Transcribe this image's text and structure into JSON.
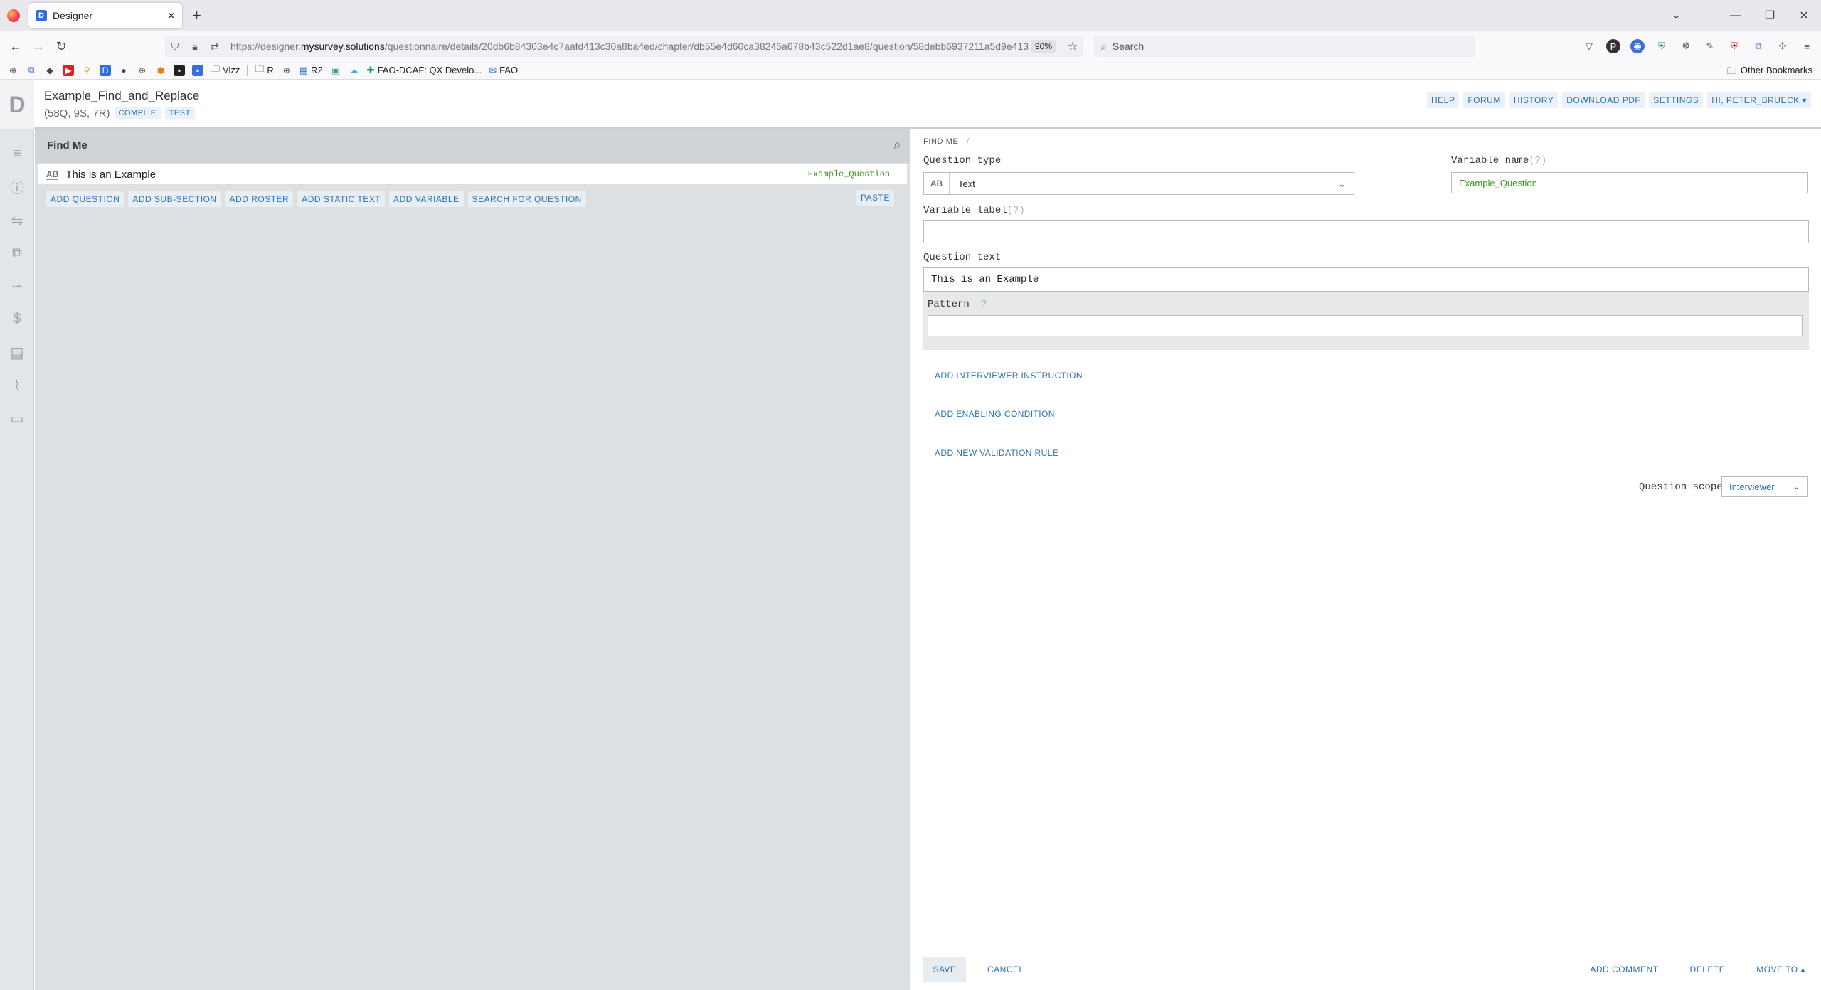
{
  "browser": {
    "tab_title": "Designer",
    "tab_favicon": "D",
    "url_host_prefix": "https://designer.",
    "url_host": "mysurvey.solutions",
    "url_path": "/questionnaire/details/20db6b84303e4c7aafd413c30a8ba4ed/chapter/db55e4d60ca38245a678b43c522d1ae8/question/58debb6937211a5d9e413",
    "zoom": "90%",
    "search_placeholder": "Search",
    "bookmarks": {
      "vizz": "Vizz",
      "r": "R",
      "r2": "R2",
      "faodcaf": "FAO-DCAF: QX Develo...",
      "fao": "FAO",
      "other": "Other Bookmarks"
    }
  },
  "header": {
    "questionnaire_title": "Example_Find_and_Replace",
    "stats": "(58Q, 9S, 7R)",
    "compile": "COMPILE",
    "test": "TEST",
    "links": {
      "help": "HELP",
      "forum": "FORUM",
      "history": "HISTORY",
      "download_pdf": "DOWNLOAD PDF",
      "settings": "SETTINGS",
      "user": "HI, PETER_BRUECK"
    }
  },
  "tree": {
    "section_title": "Find Me",
    "question": {
      "type_icon": "AB",
      "text": "This is an Example",
      "variable": "Example_Question"
    },
    "actions": {
      "add_question": "ADD QUESTION",
      "add_subsection": "ADD SUB-SECTION",
      "add_roster": "ADD ROSTER",
      "add_static_text": "ADD STATIC TEXT",
      "add_variable": "ADD VARIABLE",
      "search_for_question": "SEARCH FOR QUESTION",
      "paste": "PASTE"
    }
  },
  "editor": {
    "breadcrumb": "FIND ME",
    "breadcrumb_sep": "/",
    "question_type_label": "Question type",
    "question_type_icon": "AB",
    "question_type_value": "Text",
    "variable_name_label": "Variable name",
    "help_mark": "(?)",
    "variable_name_value": "Example_Question",
    "variable_label_label": "Variable label",
    "variable_label_value": "",
    "question_text_label": "Question text",
    "question_text_value": "This is an Example",
    "pattern_label": "Pattern",
    "pattern_help": "?",
    "pattern_value": "",
    "add_interviewer_instruction": "ADD INTERVIEWER INSTRUCTION",
    "add_enabling_condition": "ADD ENABLING CONDITION",
    "add_validation_rule": "ADD NEW VALIDATION RULE",
    "question_scope_label": "Question scope",
    "question_scope_value": "Interviewer",
    "save": "SAVE",
    "cancel": "CANCEL",
    "add_comment": "ADD COMMENT",
    "delete": "DELETE",
    "move_to": "MOVE TO ▴"
  },
  "colors": {
    "accent": "#2a72b5",
    "variable_green": "#3c9a1f"
  }
}
